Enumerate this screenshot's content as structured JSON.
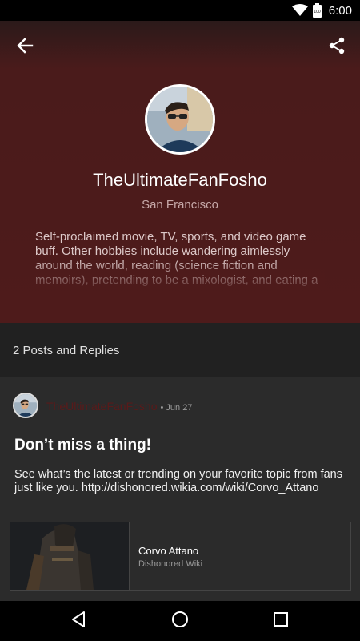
{
  "status_bar": {
    "time": "6:00",
    "battery_level": "100"
  },
  "header": {
    "back_icon": "arrow-back-icon",
    "share_icon": "share-icon"
  },
  "profile": {
    "name": "TheUltimateFanFosho",
    "location": "San Francisco",
    "bio": "Self-proclaimed movie, TV, sports, and video game buff. Other hobbies include wandering aimlessly around the world, reading (science fiction and memoirs), pretending to be a mixologist, and eating a"
  },
  "posts_summary": {
    "label": "2 Posts and Replies"
  },
  "post": {
    "author": "TheUltimateFanFosho",
    "date": "• Jun 27",
    "title": "Don’t miss a thing!",
    "body": "See what’s the latest or trending on your favorite topic from fans just like you. http://dishonored.wikia.com/wiki/Corvo_Attano",
    "preview": {
      "title": "Corvo Attano",
      "source": "Dishonored Wiki"
    }
  },
  "nav": {
    "back_icon": "nav-back-icon",
    "home_icon": "nav-home-icon",
    "recents_icon": "nav-recents-icon"
  },
  "colors": {
    "header_red": "#4e1b1b",
    "background": "#2b2b2b",
    "band": "#212121",
    "author_name": "#5a1a1a"
  }
}
